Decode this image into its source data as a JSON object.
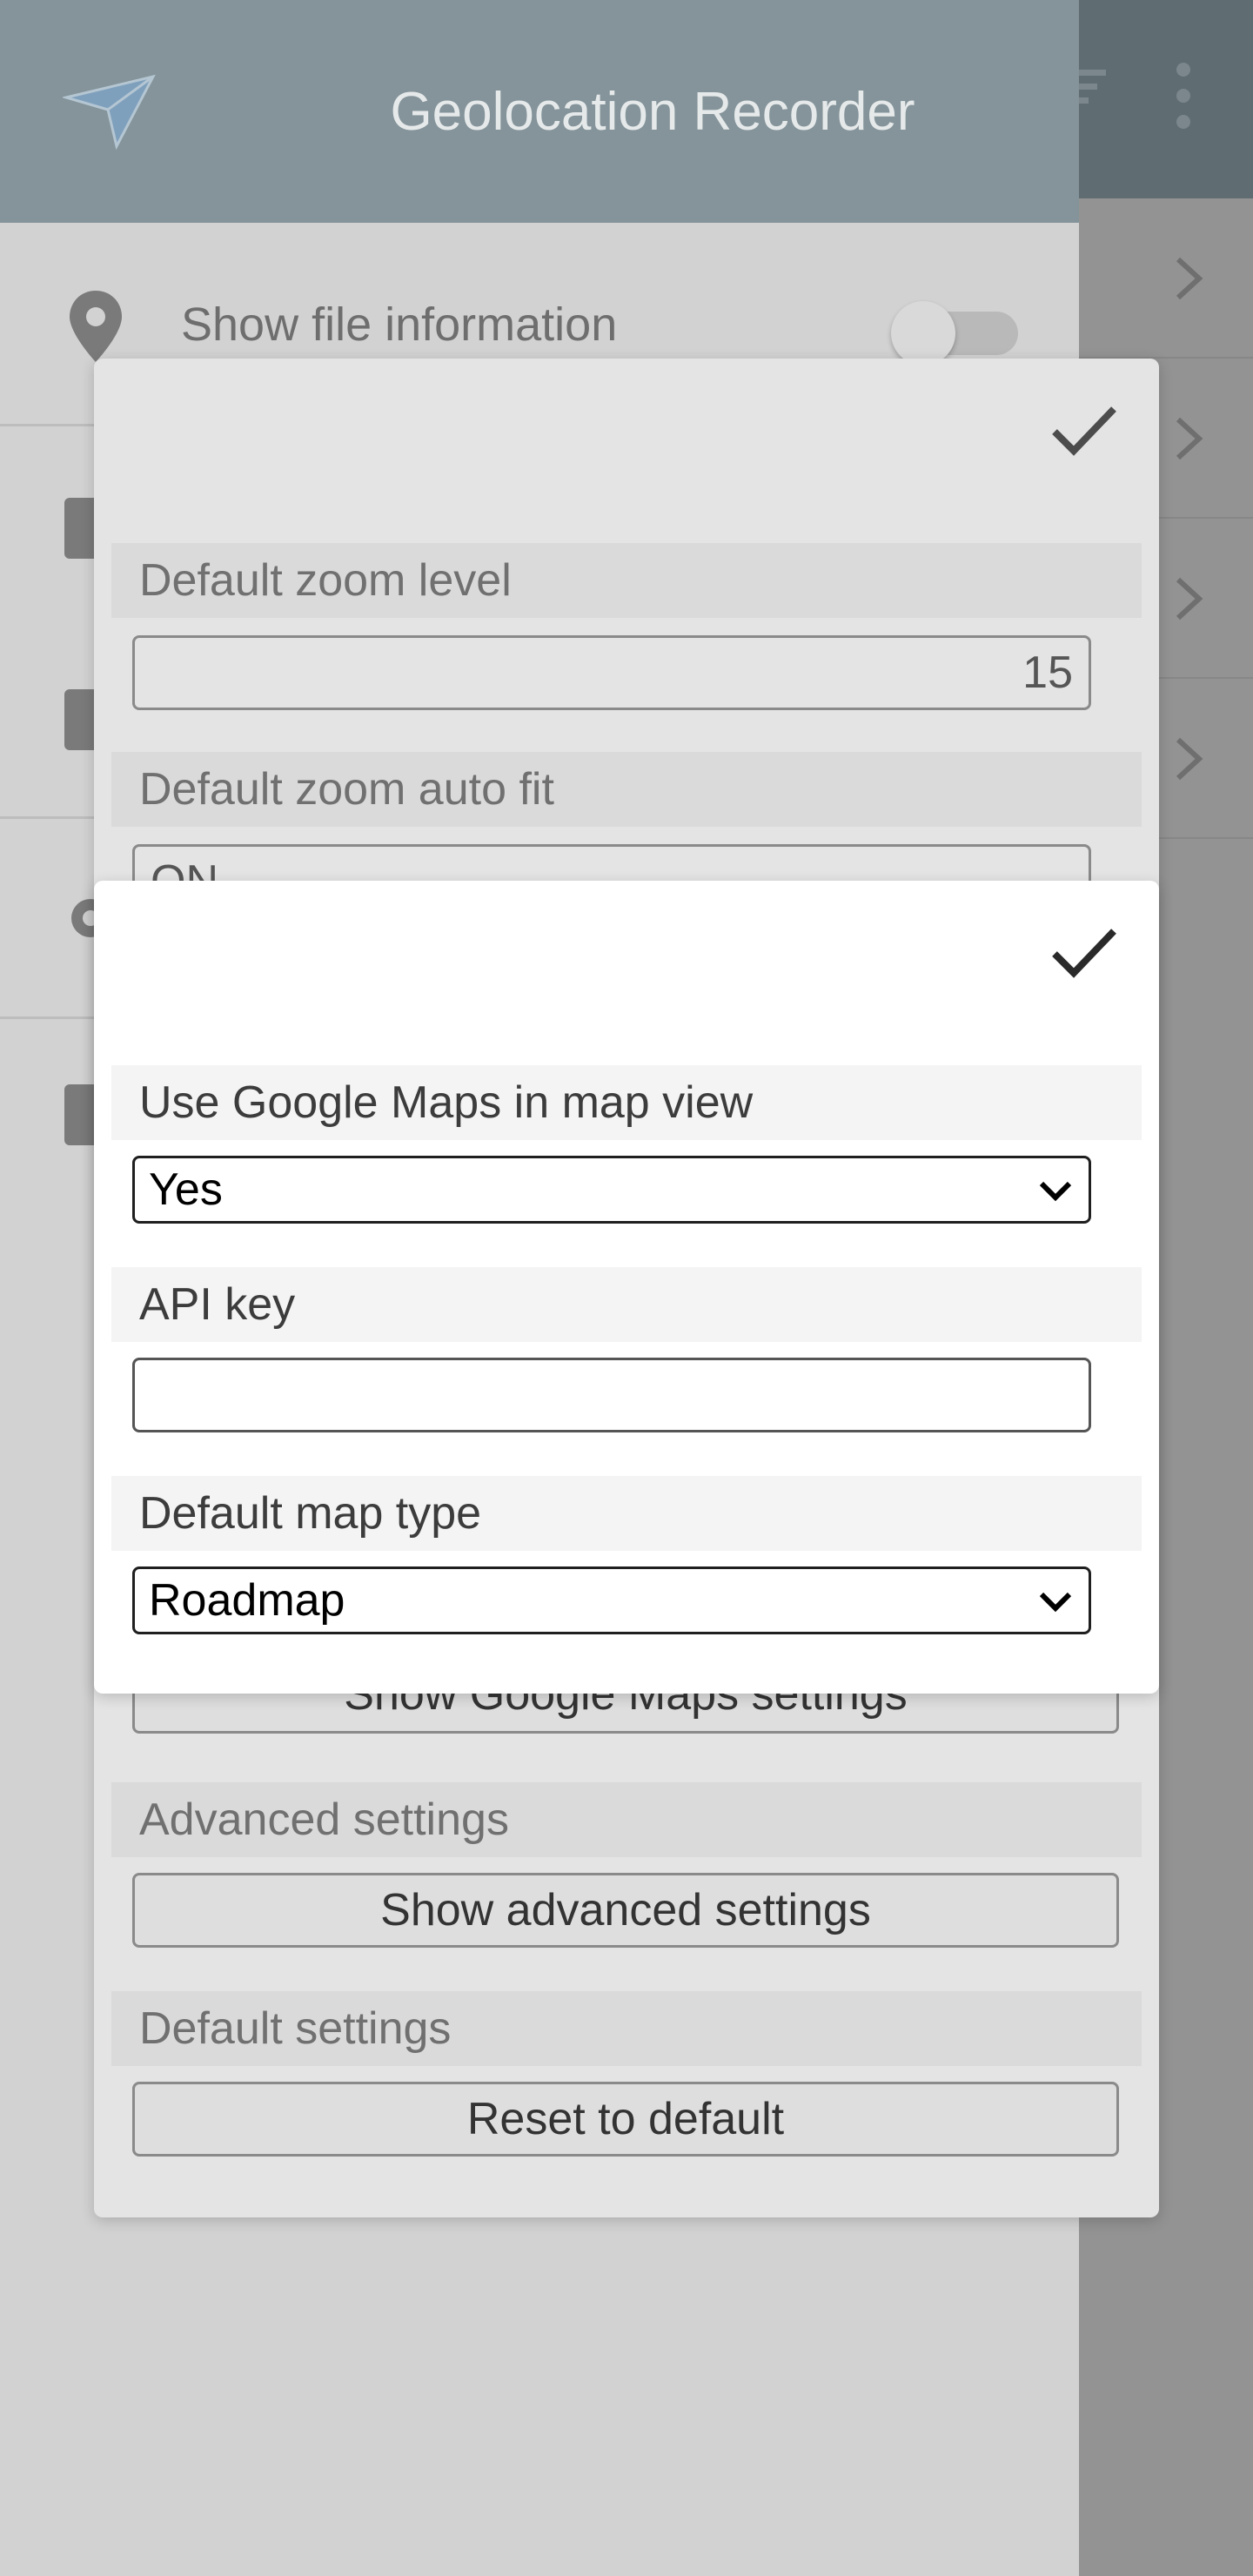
{
  "app": {
    "title": "Geolocation Recorder"
  },
  "drawer": {
    "show_file_info_label": "Show file information",
    "show_file_info_enabled": false
  },
  "settings_dialog": {
    "default_zoom_level_label": "Default zoom level",
    "default_zoom_level_value": "15",
    "default_zoom_auto_fit_label": "Default zoom auto fit",
    "default_zoom_auto_fit_value": "ON",
    "google_maps_button": "Show Google Maps settings",
    "advanced_settings_label": "Advanced settings",
    "advanced_settings_button": "Show advanced settings",
    "default_settings_label": "Default settings",
    "reset_button": "Reset to default"
  },
  "google_maps_dialog": {
    "use_google_maps_label": "Use Google Maps in map view",
    "use_google_maps_value": "Yes",
    "api_key_label": "API key",
    "api_key_value": "",
    "default_map_type_label": "Default map type",
    "default_map_type_value": "Roadmap"
  },
  "icons": [
    "paper-plane-icon",
    "pin-icon",
    "check-icon",
    "chevron-down-icon",
    "chevron-right-icon",
    "filter-icon",
    "more-vert-icon",
    "gear-icon"
  ]
}
